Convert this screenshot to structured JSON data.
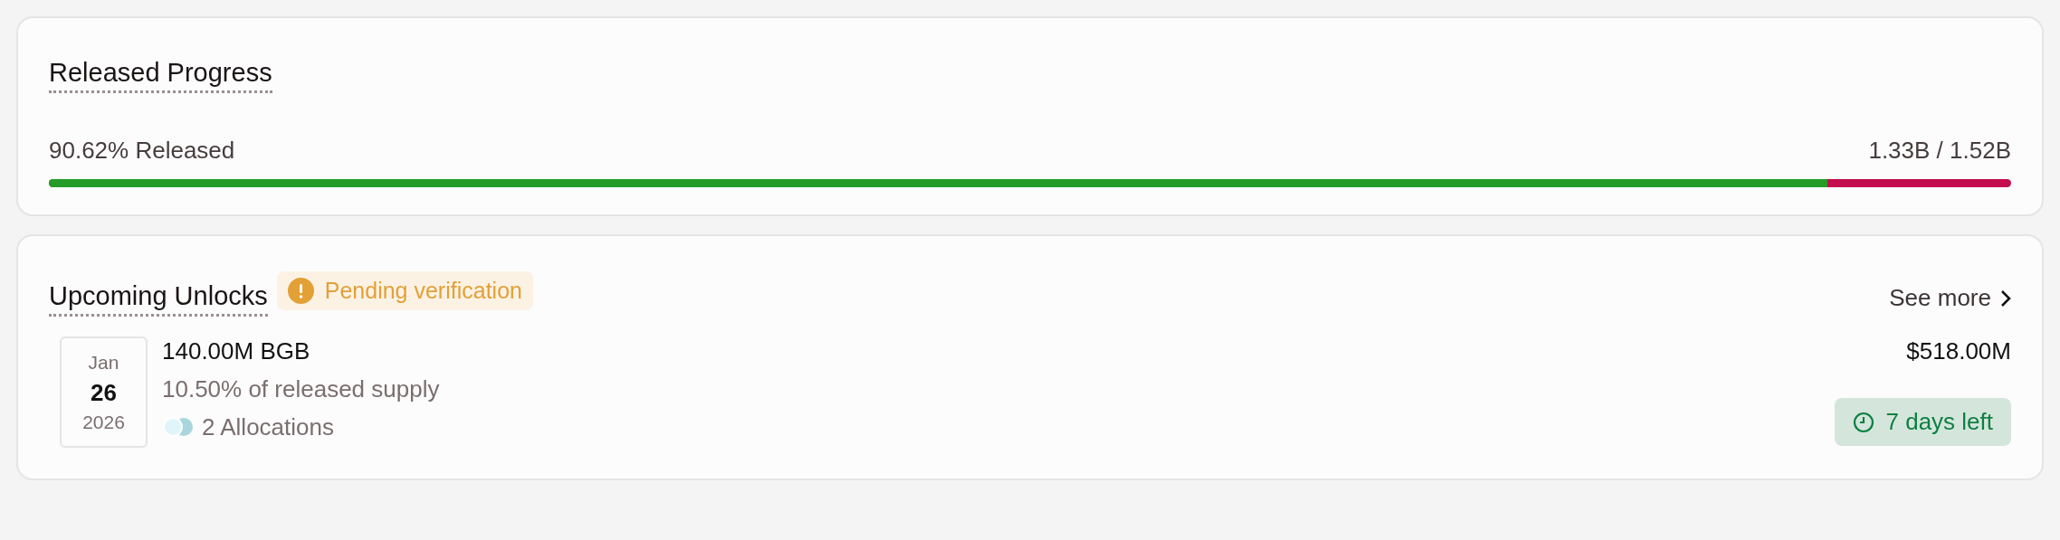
{
  "progress": {
    "title": "Released Progress",
    "label": "90.62% Released",
    "amount": "1.33B / 1.52B",
    "level": 0.9062
  },
  "unlocks": {
    "title": "Upcoming Unlocks",
    "badge": "Pending verification",
    "see_more": "See more",
    "items": [
      {
        "month": "Jan",
        "day": "26",
        "year": "2026",
        "amount": "140.00M BGB",
        "share": "10.50% of released supply",
        "allocations": "2 Allocations",
        "value": "$518.00M",
        "time_left": "7 days left"
      }
    ]
  }
}
